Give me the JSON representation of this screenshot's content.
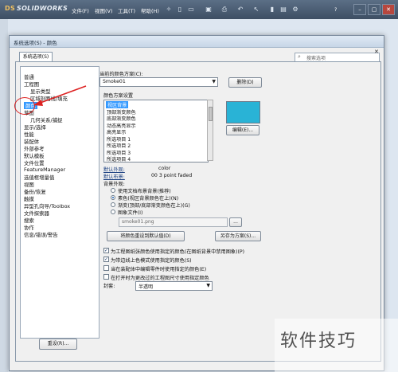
{
  "app": {
    "logo_text": "SOLIDWORKS",
    "logo_mark": "DS",
    "menus": [
      "文件(F)",
      "视图(V)",
      "工具(T)",
      "帮助(H)"
    ],
    "help_symbol": "?"
  },
  "dialog": {
    "title": "系统选项(S) - 颜色",
    "tab": "系统选项(S)",
    "search_placeholder": "搜索选项",
    "reset_label": "重设(R)..."
  },
  "tree": {
    "items": [
      {
        "label": "普通",
        "level": 0
      },
      {
        "label": "工程图",
        "level": 0
      },
      {
        "label": "显示类型",
        "level": 1
      },
      {
        "label": "区域剖面线/填充",
        "level": 1
      },
      {
        "label": "颜色",
        "level": 0,
        "selected": true
      },
      {
        "label": "草图",
        "level": 0
      },
      {
        "label": "几何关系/捕捉",
        "level": 1
      },
      {
        "label": "显示/选择",
        "level": 0
      },
      {
        "label": "性能",
        "level": 0
      },
      {
        "label": "装配体",
        "level": 0
      },
      {
        "label": "外部参考",
        "level": 0
      },
      {
        "label": "默认模板",
        "level": 0
      },
      {
        "label": "文件位置",
        "level": 0
      },
      {
        "label": "FeatureManager",
        "level": 0
      },
      {
        "label": "选值框增量值",
        "level": 0
      },
      {
        "label": "视图",
        "level": 0
      },
      {
        "label": "备份/恢复",
        "level": 0
      },
      {
        "label": "触摸",
        "level": 0
      },
      {
        "label": "异型孔向导/Toolbox",
        "level": 0
      },
      {
        "label": "文件探索器",
        "level": 0
      },
      {
        "label": "搜索",
        "level": 0
      },
      {
        "label": "协作",
        "level": 0
      },
      {
        "label": "信息/错误/警告",
        "level": 0
      }
    ]
  },
  "colors": {
    "scheme_label": "当前的颜色方案(C):",
    "scheme_value": "Smoke01",
    "delete_label": "删除(D)",
    "settings_label": "颜色方案设置",
    "list": [
      "视区背景",
      "顶部渐变颜色",
      "底部渐变颜色",
      "动态高亮显示",
      "高亮显示",
      "所选项目 1",
      "所选项目 2",
      "所选项目 3",
      "所选项目 4"
    ],
    "swatch_color": "#29b3d6",
    "edit_label": "编辑(E)...",
    "default_appearance_label": "默认外观:",
    "default_appearance_value": "color",
    "default_scene_label": "默认布景:",
    "default_scene_value": "00 3 point faded",
    "background_label": "背景外观:",
    "bg_options": [
      {
        "label": "使用文档布景背景(推荐)",
        "checked": false
      },
      {
        "label": "素色(视区背景颜色在上)(N)",
        "checked": true
      },
      {
        "label": "渐变(顶部/底部渐变颜色在上)(G)",
        "checked": false
      },
      {
        "label": "图象文件(I)",
        "checked": false
      }
    ],
    "image_file": "smoke01.png",
    "browse_label": "...",
    "reset_defaults_label": "将颜色重设到默认值(D)",
    "save_scheme_label": "另存为方案(S)...",
    "checks": [
      {
        "label": "为工程图纸张颜色使用指定的颜色(在图纸背景中禁用图象)(P)",
        "checked": true
      },
      {
        "label": "为带边线上色模式使用指定的颜色(S)",
        "checked": true
      },
      {
        "label": "当在装配体中编辑零件时使用指定的颜色(E)",
        "checked": false
      },
      {
        "label": "在打开时为更改过的工程图尺寸使用指定颜色",
        "checked": false
      }
    ],
    "envelope_label": "封套:",
    "envelope_value": "半透明"
  },
  "watermark": "软件技巧"
}
